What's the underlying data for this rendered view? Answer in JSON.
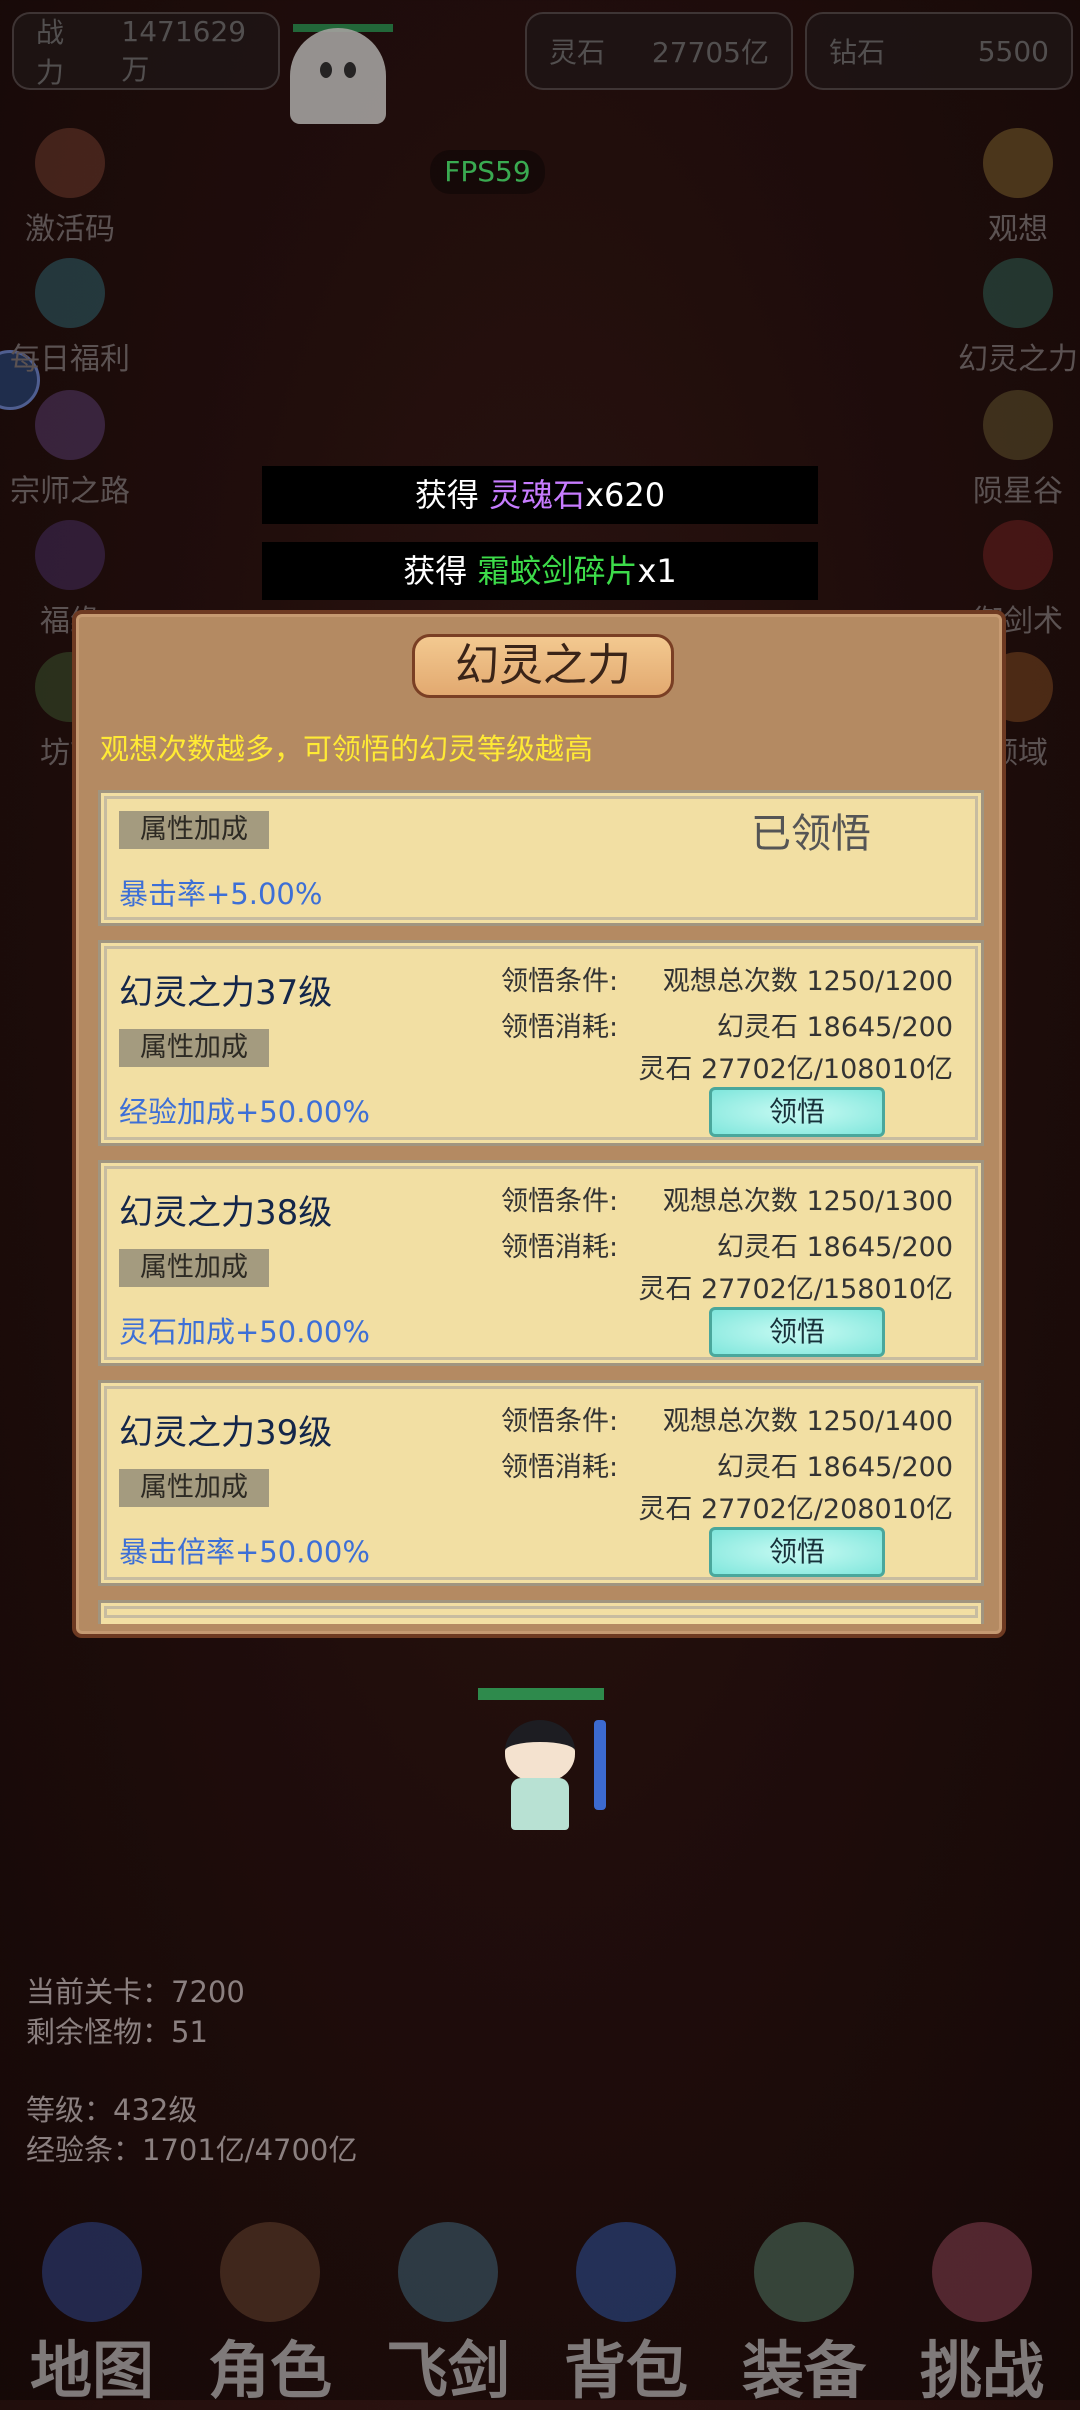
{
  "top_bar": {
    "power": {
      "label": "战力",
      "value": "1471629万"
    },
    "spirit_stone": {
      "label": "灵石",
      "value": "27705亿"
    },
    "diamond": {
      "label": "钻石",
      "value": "5500"
    }
  },
  "fps": "FPS59",
  "left_menu": [
    {
      "label": "激活码",
      "icon": "gift-icon"
    },
    {
      "label": "每日福利",
      "icon": "welfare-icon"
    },
    {
      "label": "宗师之路",
      "icon": "scroll-icon"
    },
    {
      "label": "福缘",
      "icon": "fortune-icon"
    },
    {
      "label": "坊市",
      "icon": "market-icon"
    }
  ],
  "right_menu": [
    {
      "label": "观想",
      "icon": "meditation-icon"
    },
    {
      "label": "幻灵之力",
      "icon": "phantom-icon"
    },
    {
      "label": "陨星谷",
      "icon": "mask-icon"
    },
    {
      "label": "御剑术",
      "icon": "sword-skill-icon"
    },
    {
      "label": "领域",
      "icon": "domain-icon"
    }
  ],
  "toasts": [
    {
      "prefix": "获得 ",
      "item": "灵魂石",
      "suffix": "x620",
      "color": "#c77cff"
    },
    {
      "prefix": "获得 ",
      "item": "霜蛟剑碎片",
      "suffix": "x1",
      "color": "#3ddc4a"
    }
  ],
  "popup": {
    "title": "幻灵之力",
    "hint": "观想次数越多，可领悟的幻灵等级越高",
    "attr_tag": "属性加成",
    "cond_label": "领悟条件:",
    "cost_label": "领悟消耗:",
    "learned_text": "已领悟",
    "button_label": "领悟",
    "first_card": {
      "bonus": "暴击率+5.00%"
    },
    "cards": [
      {
        "name": "幻灵之力37级",
        "bonus": "经验加成+50.00%",
        "cond": "观想总次数 1250/1200",
        "cost1": "幻灵石 18645/200",
        "cost2": "灵石 27702亿/108010亿"
      },
      {
        "name": "幻灵之力38级",
        "bonus": "灵石加成+50.00%",
        "cond": "观想总次数 1250/1300",
        "cost1": "幻灵石 18645/200",
        "cost2": "灵石 27702亿/158010亿"
      },
      {
        "name": "幻灵之力39级",
        "bonus": "暴击倍率+50.00%",
        "cond": "观想总次数 1250/1400",
        "cost1": "幻灵石 18645/200",
        "cost2": "灵石 27702亿/208010亿"
      }
    ]
  },
  "stats": {
    "stage": "当前关卡：7200",
    "monsters": "剩余怪物：51",
    "level": "等级：432级",
    "exp": "经验条：1701亿/4700亿"
  },
  "nav": [
    {
      "label": "地图",
      "icon": "map-icon"
    },
    {
      "label": "角色",
      "icon": "character-icon"
    },
    {
      "label": "飞剑",
      "icon": "flying-sword-icon"
    },
    {
      "label": "背包",
      "icon": "bag-icon"
    },
    {
      "label": "装备",
      "icon": "equipment-icon"
    },
    {
      "label": "挑战",
      "icon": "challenge-icon"
    }
  ]
}
